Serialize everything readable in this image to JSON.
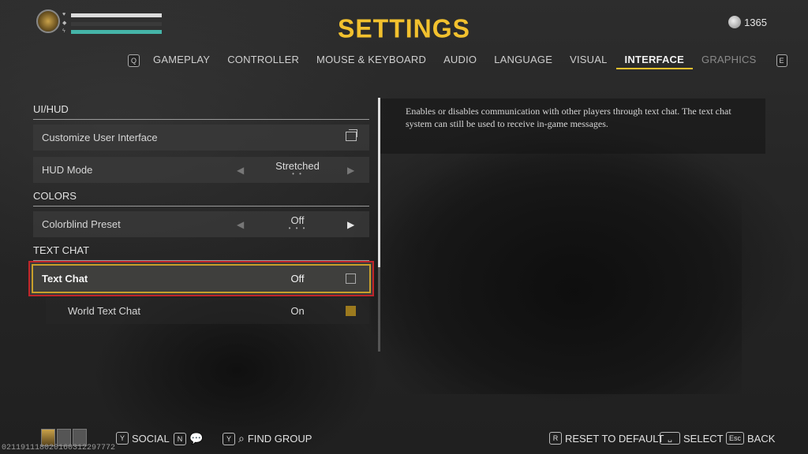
{
  "header": {
    "title": "SETTINGS",
    "currency_value": "1365",
    "currency_icon": "coin-icon",
    "stat_bars": [
      {
        "icon": "heart-icon",
        "fill_fraction": 1.0,
        "color": "#dcdcdc"
      },
      {
        "icon": "stamina-icon",
        "fill_fraction": 0.0,
        "color": "#c8a64a"
      },
      {
        "icon": "energy-icon",
        "fill_fraction": 1.0,
        "color": "#45b4a8"
      }
    ]
  },
  "tabs": {
    "prev_key": "Q",
    "next_key": "E",
    "items": [
      {
        "label": "GAMEPLAY",
        "active": false
      },
      {
        "label": "CONTROLLER",
        "active": false
      },
      {
        "label": "MOUSE & KEYBOARD",
        "active": false
      },
      {
        "label": "AUDIO",
        "active": false
      },
      {
        "label": "LANGUAGE",
        "active": false
      },
      {
        "label": "VISUAL",
        "active": false
      },
      {
        "label": "INTERFACE",
        "active": true
      },
      {
        "label": "GRAPHICS",
        "active": false
      }
    ]
  },
  "settings": {
    "ui_hud": {
      "heading": "UI/HUD",
      "customize_label": "Customize User Interface",
      "hud_mode_label": "HUD Mode",
      "hud_mode_value": "Stretched"
    },
    "colors": {
      "heading": "COLORS",
      "colorblind_label": "Colorblind Preset",
      "colorblind_value": "Off"
    },
    "text_chat": {
      "heading": "TEXT CHAT",
      "text_chat_label": "Text Chat",
      "text_chat_value": "Off",
      "text_chat_checked": false,
      "world_chat_label": "World Text Chat",
      "world_chat_value": "On",
      "world_chat_checked": true
    }
  },
  "description": "Enables or disables communication with other players through text chat. The text chat system can still be used to receive in-game messages.",
  "footer": {
    "social_key": "Y",
    "social_label": "SOCIAL",
    "chat_key": "N",
    "find_group_key": "Y",
    "find_group_label": "FIND GROUP",
    "reset_key": "R",
    "reset_label": "RESET TO DEFAULT",
    "select_label": "SELECT",
    "back_key": "Esc",
    "back_label": "BACK",
    "build_id": "021191118020160312297772"
  },
  "colors": {
    "accent_yellow": "#f2c12e",
    "highlight_red": "#c0252a"
  }
}
